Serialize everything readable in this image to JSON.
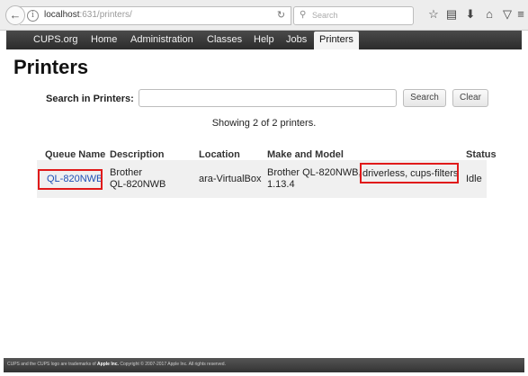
{
  "browser": {
    "url_host": "localhost",
    "url_rest": ":631/printers/",
    "search_placeholder": "Search",
    "icons": [
      "back-arrow-icon",
      "info-icon",
      "reload-icon",
      "search-icon",
      "star-icon",
      "library-icon",
      "download-icon",
      "home-icon",
      "pocket-icon",
      "menu-icon"
    ]
  },
  "nav": {
    "items": [
      "CUPS.org",
      "Home",
      "Administration",
      "Classes",
      "Help",
      "Jobs",
      "Printers"
    ],
    "active": "Printers"
  },
  "page": {
    "title": "Printers",
    "search_label": "Search in Printers:",
    "search_value": "",
    "search_button": "Search",
    "clear_button": "Clear",
    "showing": "Showing 2 of 2 printers."
  },
  "table": {
    "headers": [
      "Queue Name",
      "Description",
      "Location",
      "Make and Model",
      "Status"
    ],
    "rows": [
      {
        "queue": "QL-820NWB",
        "description_1": "Brother",
        "description_2": "QL-820NWB",
        "location": "ara-VirtualBox",
        "make_1": "Brother QL-820NWB,",
        "make_2": "1.13.4",
        "make_3": "driverless, cups-filters",
        "status": "Idle"
      }
    ]
  },
  "footer": {
    "text_1": "CUPS and the CUPS logo are trademarks of ",
    "apple": "Apple Inc.",
    "text_2": " Copyright © 2007-2017 Apple Inc. All rights reserved."
  },
  "colors": {
    "link": "#1f4fb5",
    "highlight_box": "#e01a1a",
    "nav_bg": "#3a3a3a"
  }
}
